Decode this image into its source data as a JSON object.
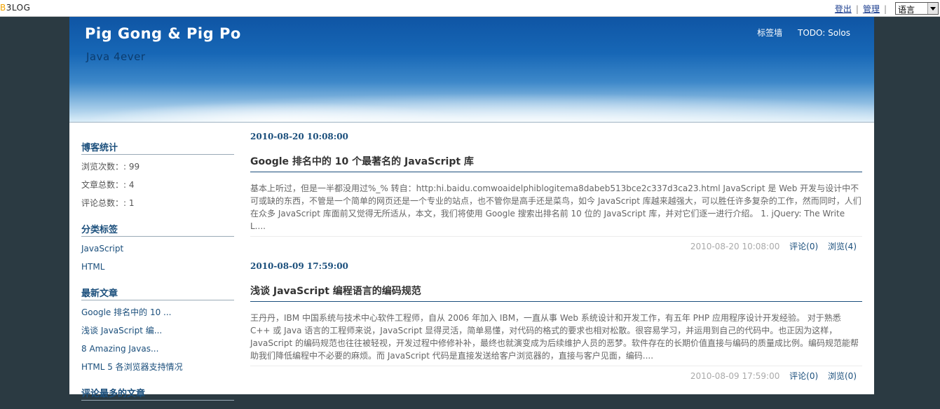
{
  "topbar": {
    "brand_prefix": "B",
    "brand_rest": "3LOG",
    "logout": "登出",
    "admin": "管理",
    "language": "语言"
  },
  "header": {
    "title": "Pig Gong & Pig Po",
    "subtitle": "Java 4ever",
    "nav": [
      "标签墙",
      "TODO: Solos"
    ]
  },
  "sidebar": {
    "stats_title": "博客统计",
    "stats": [
      "浏览次数：: 99",
      "文章总数：: 4",
      "评论总数：: 1"
    ],
    "tags_title": "分类标签",
    "tags": [
      "JavaScript",
      "HTML"
    ],
    "recent_title": "最新文章",
    "recent": [
      "Google 排名中的 10 ...",
      "浅谈 JavaScript 编...",
      "8 Amazing Javas...",
      "HTML 5 各浏览器支持情况"
    ],
    "most_commented_title": "评论最多的文章"
  },
  "posts": [
    {
      "date": "2010-08-20 10:08:00",
      "title": "Google 排名中的 10 个最著名的 JavaScript 库",
      "body": "基本上听过，但是一半都没用过%_% 转自：http:hi.baidu.comwoaidelphiblogitema8dabeb513bce2c337d3ca23.html JavaScript 是 Web 开发与设计中不可或缺的东西，不管是一个简单的网页还是一个专业的站点，也不管你是高手还是菜鸟，如今 JavaScript 库越来越强大，可以胜任许多复杂的工作，然而同时，人们在众多 JavaScript 库面前又觉得无所适从，本文，我们将使用 Google 搜索出排名前 10 位的 JavaScript 库，并对它们逐一进行介绍。 1. jQuery: The Write L....",
      "footer_date": "2010-08-20 10:08:00",
      "comments": "评论(0)",
      "views": "浏览(4)"
    },
    {
      "date": "2010-08-09 17:59:00",
      "title": "浅谈 JavaScript 编程语言的编码规范",
      "body": "王丹丹，IBM 中国系统与技术中心软件工程师，自从 2006 年加入 IBM，一直从事 Web 系统设计和开发工作，有五年 PHP 应用程序设计开发经验。 对于熟悉 C++ 或 Java 语言的工程师来说，JavaScript 显得灵活，简单易懂，对代码的格式的要求也相对松散。很容易学习，并运用到自己的代码中。也正因为这样，JavaScript 的编码规范也往往被轻视，开发过程中修修补补，最终也就演变成为后续维护人员的恶梦。软件存在的长期价值直接与编码的质量成比例。编码规范能帮助我们降低编程中不必要的麻烦。而 JavaScript 代码是直接发送给客户浏览器的，直接与客户见面，编码....",
      "footer_date": "2010-08-09 17:59:00",
      "comments": "评论(0)",
      "views": "浏览(0)"
    }
  ]
}
